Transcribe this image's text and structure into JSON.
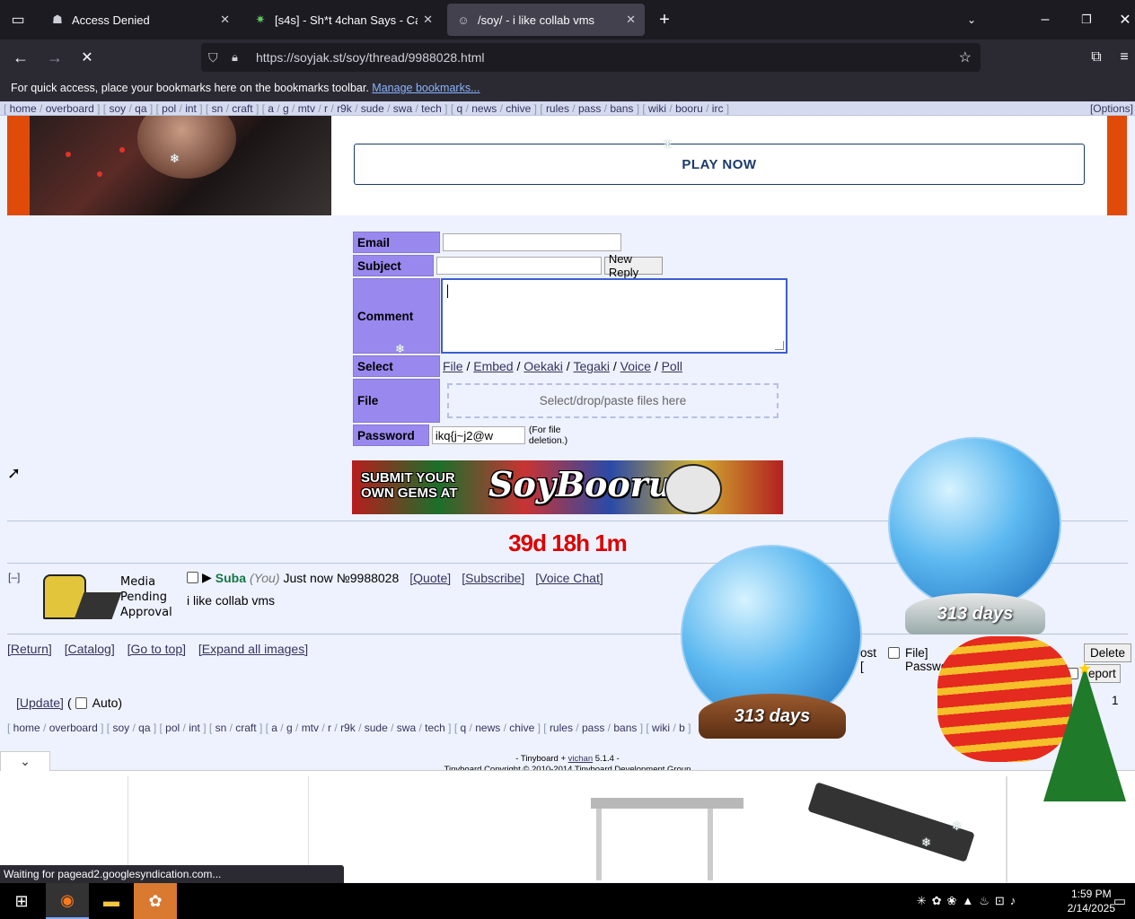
{
  "browser": {
    "tabs": [
      {
        "title": "Access Denied",
        "active": false
      },
      {
        "title": "[s4s] - Sh*t 4chan Says - Catalog",
        "active": false
      },
      {
        "title": "/soy/ - i like collab vms",
        "active": true
      }
    ],
    "url": "https://soyjak.st/soy/thread/9988028.html",
    "bookmarks_text": "For quick access, place your bookmarks here on the bookmarks toolbar.",
    "bookmarks_link": "Manage bookmarks..."
  },
  "boardnav": {
    "groups": [
      [
        "home",
        "overboard"
      ],
      [
        "soy",
        "qa"
      ],
      [
        "pol",
        "int"
      ],
      [
        "sn",
        "craft"
      ],
      [
        "a",
        "g",
        "mtv",
        "r",
        "r9k",
        "sude",
        "swa",
        "tech"
      ],
      [
        "q",
        "news",
        "chive"
      ],
      [
        "rules",
        "pass",
        "bans"
      ],
      [
        "wiki",
        "booru",
        "irc"
      ]
    ],
    "options": "[Options]"
  },
  "ad": {
    "play_label": "PLAY NOW"
  },
  "form": {
    "email_label": "Email",
    "subject_label": "Subject",
    "new_reply_label": "New Reply",
    "comment_label": "Comment",
    "select_label": "Select",
    "select_options": [
      "File",
      "Embed",
      "Oekaki",
      "Tegaki",
      "Voice",
      "Poll"
    ],
    "file_label": "File",
    "dropzone_text": "Select/drop/paste files here",
    "password_label": "Password",
    "password_value": "ikq{j~j2@w",
    "password_note": "(For file deletion.)"
  },
  "banner": {
    "line1": "SUBMIT YOUR",
    "line2": "OWN GEMS AT",
    "brand": "SoyBooru"
  },
  "countdown": "39d 18h 1m",
  "post": {
    "collapse": "[–]",
    "media_note": [
      "Media",
      "Pending",
      "Approval"
    ],
    "name": "Suba",
    "you": "(You)",
    "time": "Just now",
    "number": "№9988028",
    "actions": [
      "[Quote]",
      "[Subscribe]",
      "[Voice Chat]"
    ],
    "body": "i like collab vms"
  },
  "bottom_links": [
    "[Return]",
    "[Catalog]",
    "[Go to top]",
    "[Expand all images]"
  ],
  "update": {
    "link": "[Update]",
    "auto": "Auto)",
    "paren": "("
  },
  "controls": {
    "delete_fragment": "ost [",
    "file_fragment": "File] Passwo",
    "delete_button": "Delete",
    "report_fragment": "ort",
    "report_button": "eport",
    "page_fragment": "1"
  },
  "footnav": {
    "groups": [
      [
        "home",
        "overboard"
      ],
      [
        "soy",
        "qa"
      ],
      [
        "pol",
        "int"
      ],
      [
        "sn",
        "craft"
      ],
      [
        "a",
        "g",
        "mtv",
        "r",
        "r9k",
        "sude",
        "swa",
        "tech"
      ],
      [
        "q",
        "news",
        "chive"
      ],
      [
        "rules",
        "pass",
        "bans"
      ],
      [
        "wiki",
        "b"
      ]
    ]
  },
  "tinyboard": {
    "prefix": "- Tinyboard +",
    "link": "vichan",
    "suffix": "5.1.4 -",
    "copyright": "Tinyboard Copyright © 2010-2014 Tinyboard Development Group"
  },
  "decor": {
    "globe1_label": "313 days",
    "globe2_label": "313 days"
  },
  "status": "Waiting for pagead2.googlesyndication.com...",
  "clock": {
    "time": "1:59 PM",
    "date": "2/14/2025"
  }
}
